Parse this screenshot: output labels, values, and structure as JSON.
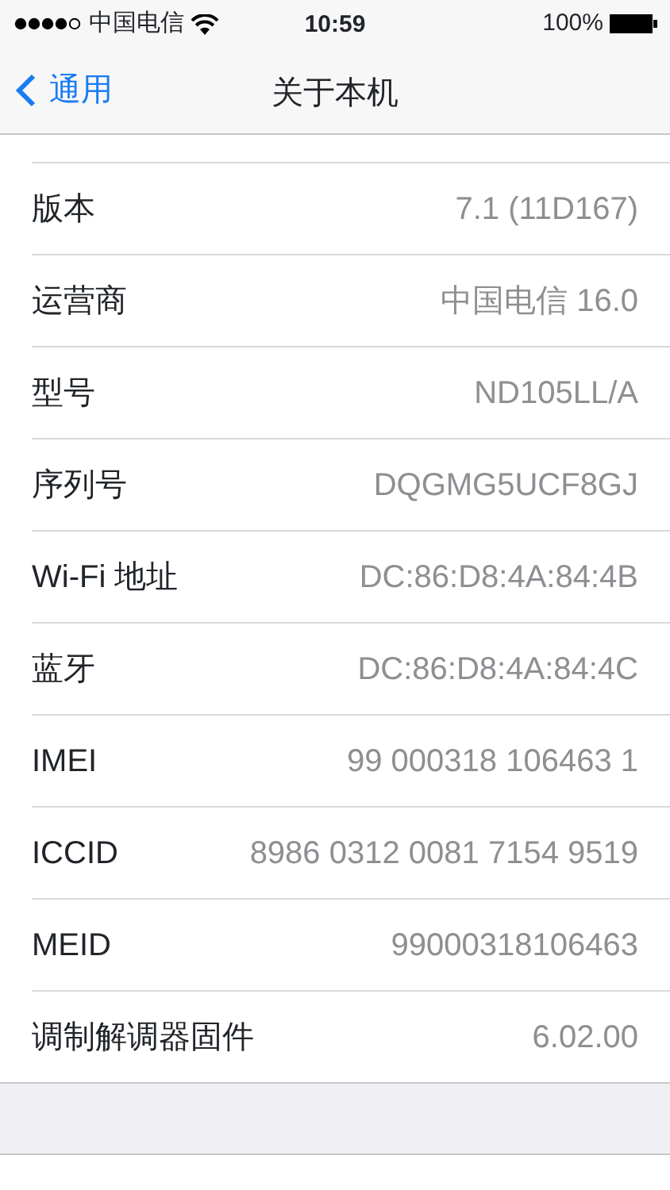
{
  "status_bar": {
    "carrier": "中国电信",
    "time": "10:59",
    "battery": "100%"
  },
  "nav_bar": {
    "back": "通用",
    "title": "关于本机"
  },
  "rows": [
    {
      "label": "版本",
      "value": "7.1 (11D167)"
    },
    {
      "label": "运营商",
      "value": "中国电信 16.0"
    },
    {
      "label": "型号",
      "value": "ND105LL/A"
    },
    {
      "label": "序列号",
      "value": "DQGMG5UCF8GJ"
    },
    {
      "label": "Wi-Fi 地址",
      "value": "DC:86:D8:4A:84:4B"
    },
    {
      "label": "蓝牙",
      "value": "DC:86:D8:4A:84:4C"
    },
    {
      "label": "IMEI",
      "value": "99 000318 106463 1"
    },
    {
      "label": "ICCID",
      "value": "8986 0312 0081 7154 9519"
    },
    {
      "label": "MEID",
      "value": "99000318106463"
    },
    {
      "label": "调制解调器固件",
      "value": "6.02.00"
    }
  ]
}
